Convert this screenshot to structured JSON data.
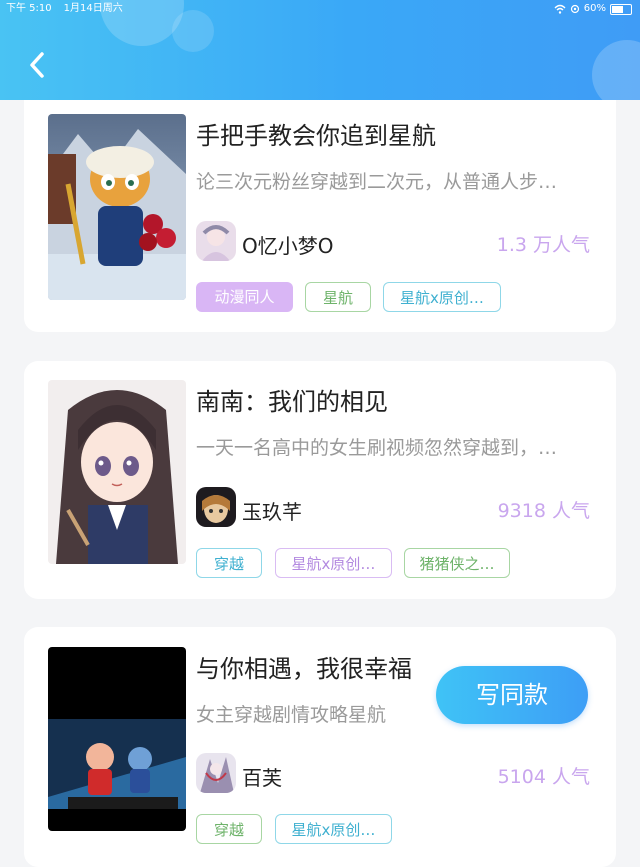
{
  "status_bar": {
    "time": "下午 5:10",
    "date": "1月14日周六",
    "battery": "60%"
  },
  "works": [
    {
      "title": "手把手教会你追到星航",
      "desc": "论三次元粉丝穿越到二次元，从普通人步…",
      "author": "O忆小梦O",
      "popularity": "1.3 万人气",
      "tags": [
        "动漫同人",
        "星航",
        "星航x原创…"
      ]
    },
    {
      "title": "南南：我们的相见",
      "desc": "一天一名高中的女生刷视频忽然穿越到，…",
      "author": "玉玖芊",
      "popularity": "9318 人气",
      "tags": [
        "穿越",
        "星航x原创…",
        "猪猪侠之…"
      ]
    },
    {
      "title": "与你相遇，我很幸福",
      "desc": "女主穿越剧情攻略星航",
      "author": "百芙",
      "popularity": "5104 人气",
      "tags": [
        "穿越",
        "星航x原创…"
      ]
    }
  ],
  "write_button": "写同款",
  "colors": {
    "header": "#3aa8f7",
    "popularity": "#c9a6ee",
    "button": "#3d9ef6"
  }
}
